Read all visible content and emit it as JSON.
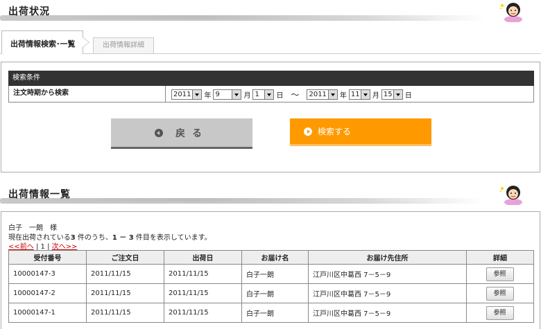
{
  "sections": {
    "shipping_status_title": "出荷状況",
    "shipping_list_title": "出荷情報一覧"
  },
  "tabs": [
    {
      "label": "出荷情報検索･一覧",
      "active": true
    },
    {
      "label": "出荷情報詳細",
      "active": false
    }
  ],
  "search": {
    "header": "検索条件",
    "row_label": "注文時期から検索",
    "from": {
      "year": "2011",
      "month": "9",
      "day": "1"
    },
    "to": {
      "year": "2011",
      "month": "11",
      "day": "15"
    },
    "unit_year": "年",
    "unit_month": "月",
    "unit_day": "日",
    "tilde": "～",
    "back_label": "戻る",
    "search_label": "検索する"
  },
  "list": {
    "customer": "白子　一朗　様",
    "count_prefix": "現在出荷されている",
    "count_total": "3",
    "count_mid": " 件のうち、",
    "count_range": "1 － 3",
    "count_suffix": " 件目を表示しています。",
    "prev_label": "<<前へ",
    "sep1": "|",
    "page": "1",
    "sep2": "|",
    "next_label": "次へ>>",
    "columns": [
      "受付番号",
      "ご注文日",
      "出荷日",
      "お届け名",
      "お届け先住所",
      "詳細"
    ],
    "rows": [
      {
        "id": "10000147-3",
        "order_date": "2011/11/15",
        "ship_date": "2011/11/15",
        "name": "白子一朗",
        "address": "江戸川区中葛西 7－5－9",
        "action": "参照"
      },
      {
        "id": "10000147-2",
        "order_date": "2011/11/15",
        "ship_date": "2011/11/15",
        "name": "白子一朗",
        "address": "江戸川区中葛西 7－5－9",
        "action": "参照"
      },
      {
        "id": "10000147-1",
        "order_date": "2011/11/15",
        "ship_date": "2011/11/15",
        "name": "白子一朗",
        "address": "江戸川区中葛西 7－5－9",
        "action": "参照"
      }
    ]
  },
  "colors": {
    "accent": "#ff9900",
    "header_dark": "#333333",
    "link": "#cc0000"
  },
  "icons": [
    "mascot-icon",
    "back-arrow-icon",
    "play-icon",
    "dropdown-arrow-icon"
  ]
}
